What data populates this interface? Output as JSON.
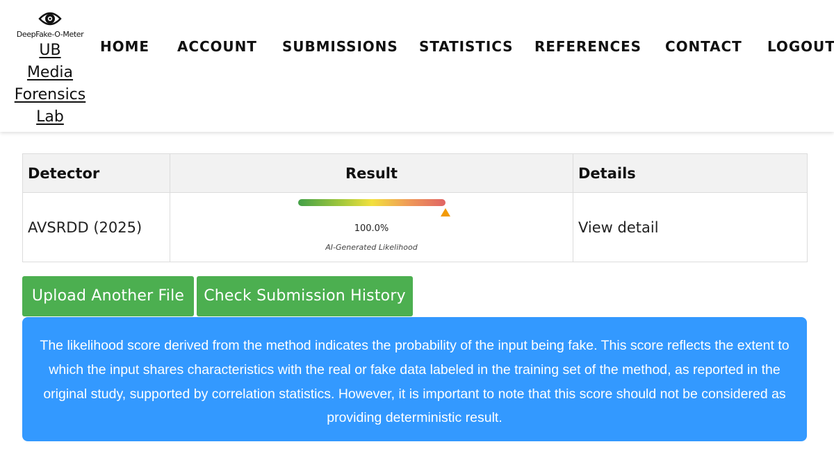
{
  "brand": {
    "tagline": "DeepFake-O-Meter",
    "lab_lines": [
      "UB",
      "Media",
      "Forensics",
      "Lab"
    ],
    "logo_icon": "eye-icon"
  },
  "nav": {
    "items": [
      "HOME",
      "ACCOUNT",
      "SUBMISSIONS",
      "STATISTICS",
      "REFERENCES",
      "CONTACT",
      "LOGOUT"
    ]
  },
  "table": {
    "headers": {
      "detector": "Detector",
      "result": "Result",
      "details": "Details"
    },
    "rows": [
      {
        "detector": "AVSRDD (2025)",
        "score_text": "100.0%",
        "score_fraction": 1.0,
        "score_caption": "AI-Generated Likelihood",
        "details_link": "View detail"
      }
    ]
  },
  "actions": {
    "upload_label": "Upload Another File",
    "history_label": "Check Submission History"
  },
  "info": {
    "text": "The likelihood score derived from the method indicates the probability of the input being fake. This score reflects the extent to which the input shares characteristics with the real or fake data labeled in the training set of the method, as reported in the original study, supported by correlation statistics. However, it is important to note that this score should not be considered as providing deterministic result."
  },
  "colors": {
    "button_green": "#4caf50",
    "info_blue": "#3399ff",
    "marker_orange": "#f29a05"
  }
}
